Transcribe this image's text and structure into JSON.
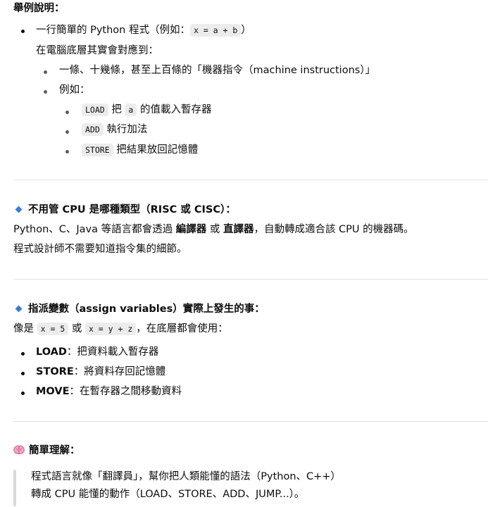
{
  "example": {
    "heading": "舉例說明：",
    "item1_prefix": "一行簡單的 Python 程式（例如：",
    "item1_code": "x = a + b",
    "item1_suffix": "）",
    "item1_sub": "在電腦底層其實會對應到：",
    "sub1": "一條、十幾條，甚至上百條的「機器指令（machine instructions）」",
    "sub2": "例如：",
    "ops": [
      {
        "code": "LOAD",
        "pre": "把",
        "mid": "a",
        "post": "的值載入暫存器"
      },
      {
        "code": "ADD",
        "pre": "執行加法",
        "mid": "",
        "post": ""
      },
      {
        "code": "STORE",
        "pre": "把結果放回記憶體",
        "mid": "",
        "post": ""
      }
    ]
  },
  "section2": {
    "title": "不用管 CPU 是哪種類型（RISC 或 CISC）：",
    "line1_pre": "Python、C、Java 等語言都會透過 ",
    "line1_b1": "編譯器",
    "line1_mid": " 或 ",
    "line1_b2": "直譯器",
    "line1_post": "，自動轉成適合該 CPU 的機器碼。",
    "line2": "程式設計師不需要知道指令集的細節。"
  },
  "section3": {
    "title": "指派變數（assign variables）實際上發生的事：",
    "line_pre": "像是 ",
    "code1": "x = 5",
    "line_or": " 或 ",
    "code2": "x = y + z",
    "line_post": "，在底層都會使用：",
    "items": [
      {
        "term": "LOAD",
        "desc": "：把資料載入暫存器"
      },
      {
        "term": "STORE",
        "desc": "：將資料存回記憶體"
      },
      {
        "term": "MOVE",
        "desc": "：在暫存器之間移動資料"
      }
    ]
  },
  "section4": {
    "title": "簡單理解：",
    "quote1": "程式語言就像「翻譯員」，幫你把人類能懂的語法（Python、C++）",
    "quote2": "轉成 CPU 能懂的動作（LOAD、STORE、ADD、JUMP...）。"
  },
  "colors": {
    "accent": "#3a7bd5",
    "code_bg": "#ececec",
    "divider": "#e3e3e3"
  },
  "icons": {
    "diamond": "small-blue-diamond-icon",
    "brain": "brain-icon"
  }
}
